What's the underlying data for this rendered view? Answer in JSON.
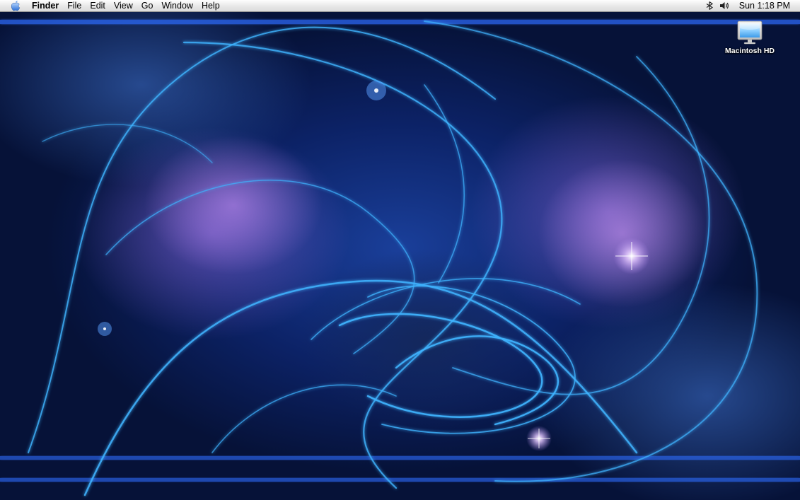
{
  "menubar": {
    "apple_icon": "apple-icon",
    "app_name": "Finder",
    "items": [
      "File",
      "Edit",
      "View",
      "Go",
      "Window",
      "Help"
    ],
    "status_icons": [
      "bluetooth-icon",
      "volume-icon"
    ],
    "clock": "Sun 1:18 PM"
  },
  "desktop": {
    "icons": [
      {
        "icon": "hard-drive-icon",
        "label": "Macintosh HD"
      }
    ],
    "wallpaper": {
      "colors": [
        "#0c2266",
        "#1a3f9a",
        "#3fa8ff",
        "#b48cf0"
      ]
    }
  }
}
